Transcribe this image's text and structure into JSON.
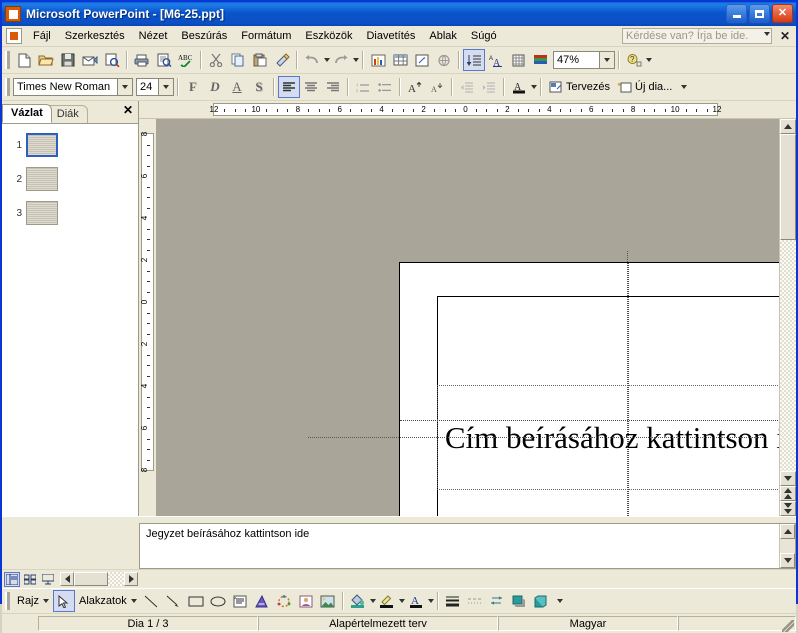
{
  "window": {
    "title": "Microsoft PowerPoint - [M6-25.ppt]",
    "app_icon": "powerpoint-icon",
    "minimize": "Minimize",
    "restore": "Restore",
    "close": "Close"
  },
  "menu": {
    "items": [
      {
        "label": "Fájl"
      },
      {
        "label": "Szerkesztés"
      },
      {
        "label": "Nézet"
      },
      {
        "label": "Beszúrás"
      },
      {
        "label": "Formátum"
      },
      {
        "label": "Eszközök"
      },
      {
        "label": "Diavetítés"
      },
      {
        "label": "Ablak"
      },
      {
        "label": "Súgó"
      }
    ],
    "ask_placeholder": "Kérdése van? Írja be ide.",
    "close_label": "✕"
  },
  "standard_toolbar": {
    "buttons": [
      {
        "name": "new-document-icon"
      },
      {
        "name": "open-folder-icon"
      },
      {
        "name": "save-icon"
      },
      {
        "name": "email-icon"
      },
      {
        "name": "search-icon"
      },
      {
        "name": "print-icon"
      },
      {
        "name": "print-preview-icon"
      },
      {
        "name": "spelling-check-icon"
      },
      {
        "name": "cut-scissors-icon"
      },
      {
        "name": "copy-icon"
      },
      {
        "name": "paste-icon"
      },
      {
        "name": "format-painter-icon"
      },
      {
        "name": "undo-icon"
      },
      {
        "name": "redo-icon"
      },
      {
        "name": "insert-chart-icon"
      },
      {
        "name": "insert-table-icon"
      },
      {
        "name": "insert-diagram-icon"
      },
      {
        "name": "hyperlink-icon"
      },
      {
        "name": "expand-all-icon"
      },
      {
        "name": "show-formatting-icon"
      },
      {
        "name": "grid-icon"
      },
      {
        "name": "color-scheme-icon"
      },
      {
        "name": "help-icon"
      }
    ],
    "zoom_value": "47%"
  },
  "formatting_toolbar": {
    "font_name": "Times New Roman",
    "font_size": "24",
    "bold_label": "F",
    "italic_label": "D",
    "underline_label": "A",
    "shadow_label": "S",
    "design_label": "Tervezés",
    "new_slide_label": "Új dia..."
  },
  "left_pane": {
    "tabs": [
      {
        "label": "Vázlat",
        "active": true
      },
      {
        "label": "Diák",
        "active": false
      }
    ],
    "close_label": "✕",
    "slides": [
      {
        "number": "1",
        "selected": true
      },
      {
        "number": "2",
        "selected": false
      },
      {
        "number": "3",
        "selected": false
      }
    ]
  },
  "rulers": {
    "horizontal_ticks": [
      "12",
      "10",
      "8",
      "6",
      "4",
      "2",
      "0",
      "2",
      "4",
      "6",
      "8",
      "10",
      "12"
    ],
    "vertical_ticks": [
      "8",
      "6",
      "4",
      "2",
      "0",
      "2",
      "4",
      "6",
      "8"
    ]
  },
  "slide": {
    "title_placeholder": "Cím beírásához kattintson ide"
  },
  "notes": {
    "placeholder": "Jegyzet beírásához kattintson ide"
  },
  "view_bar": {
    "buttons": [
      {
        "name": "normal-view-icon",
        "active": true
      },
      {
        "name": "slide-sorter-view-icon",
        "active": false
      },
      {
        "name": "slideshow-view-icon",
        "active": false
      }
    ]
  },
  "drawing_toolbar": {
    "draw_label": "Rajz",
    "autoshapes_label": "Alakzatok",
    "tools": [
      {
        "name": "select-arrow-icon"
      },
      {
        "name": "line-icon"
      },
      {
        "name": "arrow-icon"
      },
      {
        "name": "rectangle-icon"
      },
      {
        "name": "oval-icon"
      },
      {
        "name": "text-box-icon"
      },
      {
        "name": "wordart-icon"
      },
      {
        "name": "diagram-icon"
      },
      {
        "name": "clip-art-icon"
      },
      {
        "name": "picture-icon"
      },
      {
        "name": "fill-color-icon"
      },
      {
        "name": "line-color-icon"
      },
      {
        "name": "font-color-icon"
      },
      {
        "name": "line-style-icon"
      },
      {
        "name": "dash-style-icon"
      },
      {
        "name": "arrow-style-icon"
      },
      {
        "name": "shadow-style-icon"
      },
      {
        "name": "3d-style-icon"
      }
    ]
  },
  "status_bar": {
    "slide_counter": "Dia 1 / 3",
    "design_name": "Alapértelmezett terv",
    "language": "Magyar"
  },
  "colors": {
    "titlebar_blue": "#0a55cc",
    "close_red": "#d63a12",
    "toolbar_bg": "#ece9d8",
    "canvas_gray": "#a9a598",
    "slide_white": "#ffffff"
  }
}
